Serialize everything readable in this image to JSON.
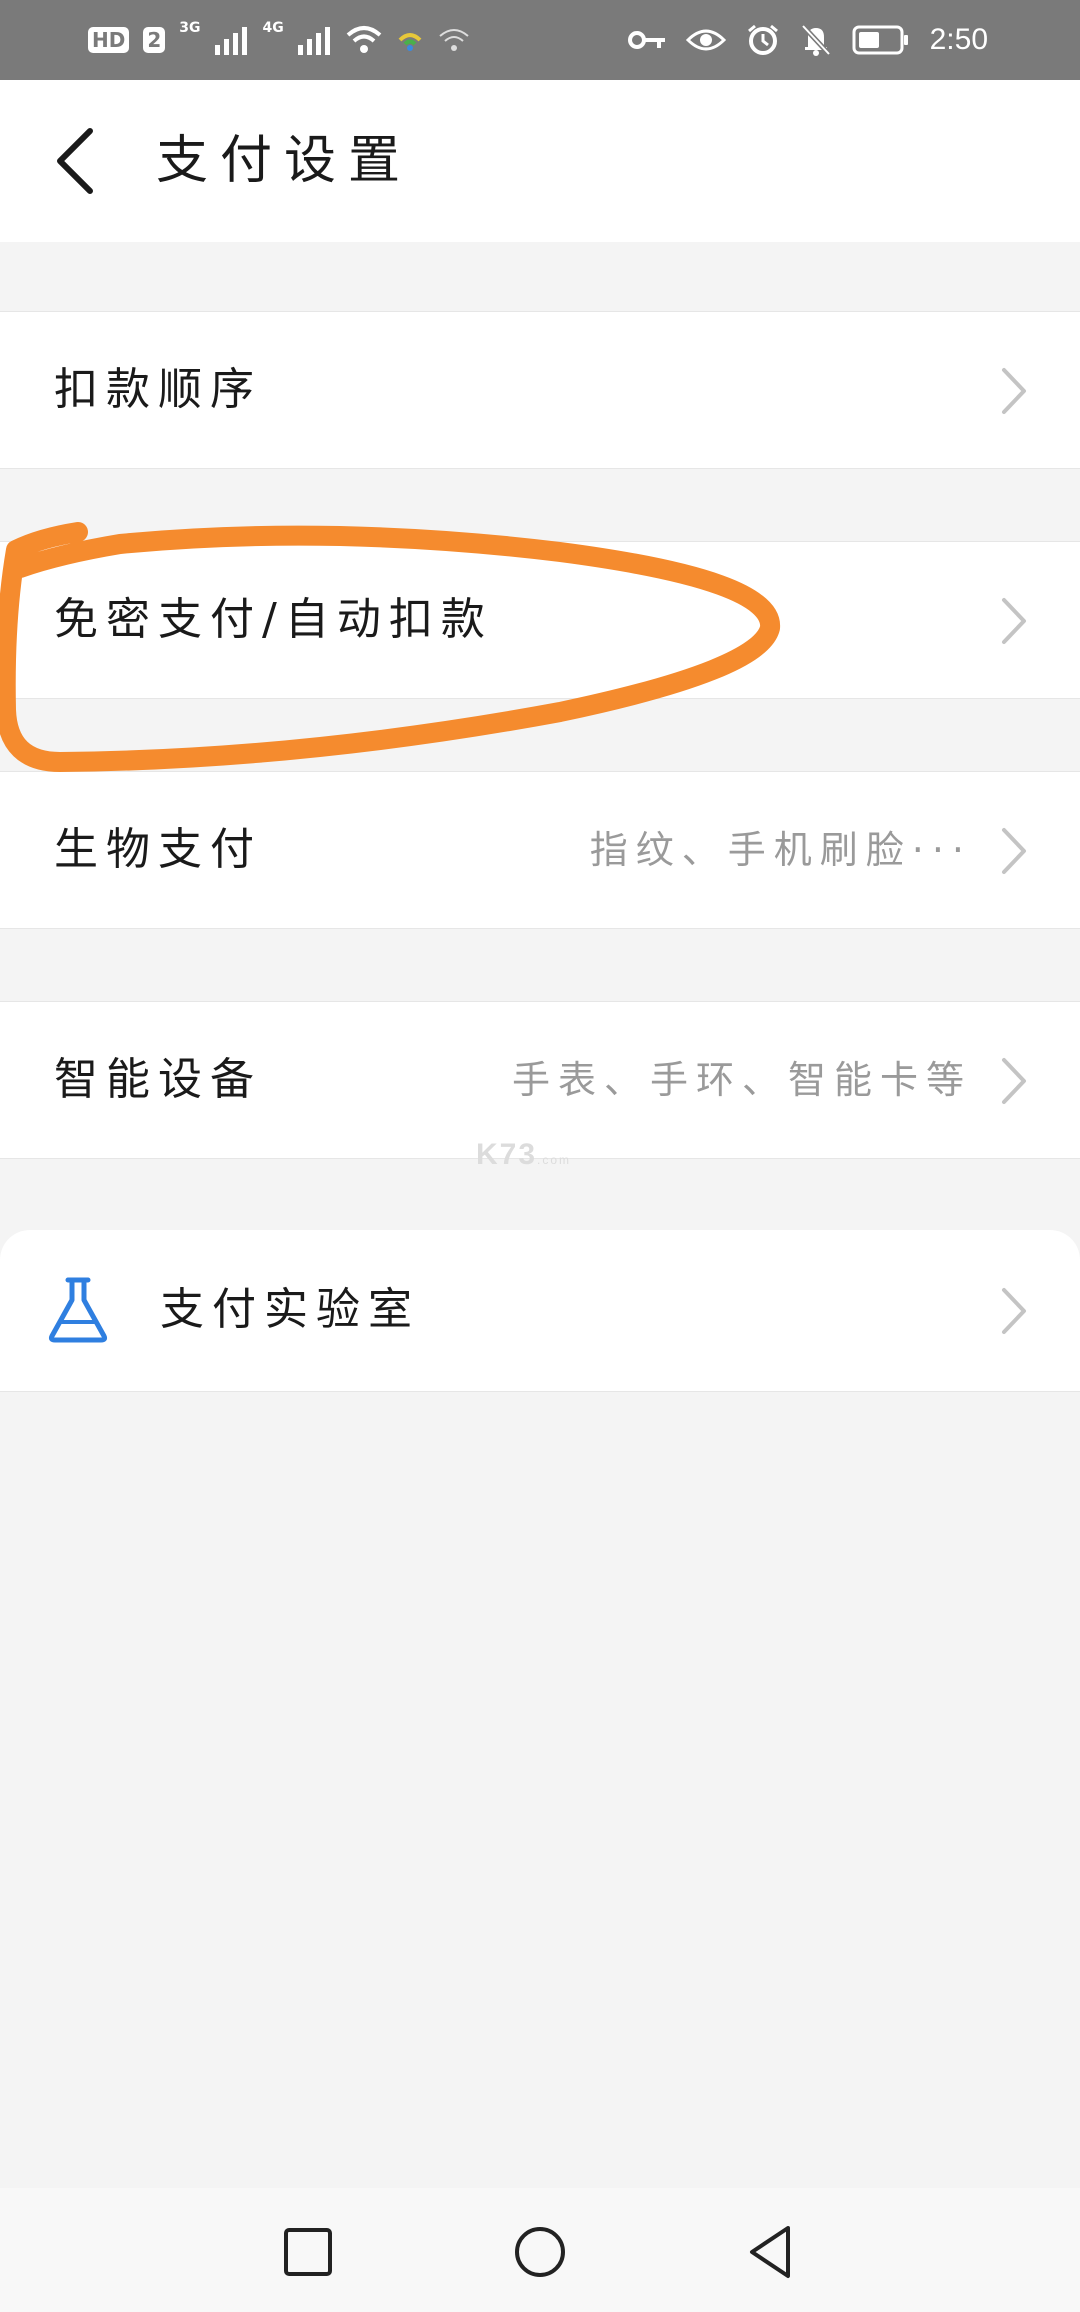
{
  "status_bar": {
    "left_badge_hd": "HD",
    "left_badge_sim": "2",
    "net1": "3G",
    "net2": "4G",
    "time": "2:50"
  },
  "header": {
    "title": "支付设置"
  },
  "rows": [
    {
      "label": "扣款顺序",
      "value": ""
    },
    {
      "label": "免密支付/自动扣款",
      "value": ""
    },
    {
      "label": "生物支付",
      "value": "指纹、手机刷脸···"
    },
    {
      "label": "智能设备",
      "value": "手表、手环、智能卡等"
    }
  ],
  "lab": {
    "label": "支付实验室",
    "icon": "flask-icon"
  },
  "watermark": {
    "brand": "K73",
    "sub": ".com"
  },
  "colors": {
    "status_bar_bg": "#7a7a7a",
    "page_bg": "#f4f4f4",
    "annotation_orange": "#f58b2e",
    "flask_blue": "#2f7fe0",
    "chevron_gray": "#c4c4c4"
  },
  "nav": {
    "icons": [
      "square-recent-icon",
      "circle-home-icon",
      "triangle-back-icon"
    ]
  }
}
